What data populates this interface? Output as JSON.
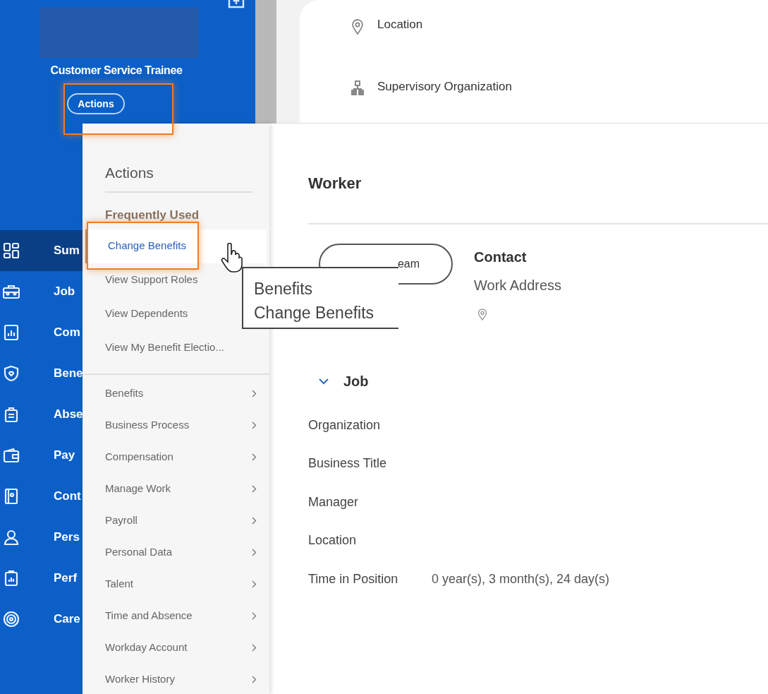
{
  "sidebar": {
    "title": "Customer Service Trainee",
    "actions_button": "Actions",
    "nav_items": [
      {
        "label": "Sum",
        "selected": true
      },
      {
        "label": "Job",
        "selected": false
      },
      {
        "label": "Com",
        "selected": false
      },
      {
        "label": "Bene",
        "selected": false
      },
      {
        "label": "Abse",
        "selected": false
      },
      {
        "label": "Pay",
        "selected": false
      },
      {
        "label": "Cont",
        "selected": false
      },
      {
        "label": "Pers",
        "selected": false
      },
      {
        "label": "Perf",
        "selected": false
      },
      {
        "label": "Care",
        "selected": false
      }
    ]
  },
  "actions_menu": {
    "title": "Actions",
    "frequently_used_heading": "Frequently Used",
    "frequent_items": [
      {
        "label": "Change Benefits",
        "selected": true
      },
      {
        "label": "View Support Roles",
        "selected": false
      },
      {
        "label": "View Dependents",
        "selected": false
      },
      {
        "label": "View My Benefit Electio...",
        "selected": false
      }
    ],
    "categories": [
      "Benefits",
      "Business Process",
      "Compensation",
      "Manage Work",
      "Payroll",
      "Personal Data",
      "Talent",
      "Time and Absence",
      "Workday Account",
      "Worker History"
    ]
  },
  "tooltip": {
    "lines": [
      "Benefits",
      "Change Benefits"
    ]
  },
  "summary_card": {
    "rows": [
      {
        "kind": "location",
        "label": "Location"
      },
      {
        "kind": "organization",
        "label": "Supervisory Organization"
      }
    ]
  },
  "worker": {
    "title": "Worker",
    "team_button": "eam",
    "contact": {
      "title": "Contact",
      "address_label": "Work Address"
    }
  },
  "job": {
    "title": "Job",
    "expanded": true,
    "fields": [
      {
        "label": "Organization"
      },
      {
        "label": "Business Title"
      },
      {
        "label": "Manager"
      },
      {
        "label": "Location"
      },
      {
        "label": "Time in Position",
        "value": "0 year(s), 3 month(s), 24 day(s)"
      }
    ]
  }
}
